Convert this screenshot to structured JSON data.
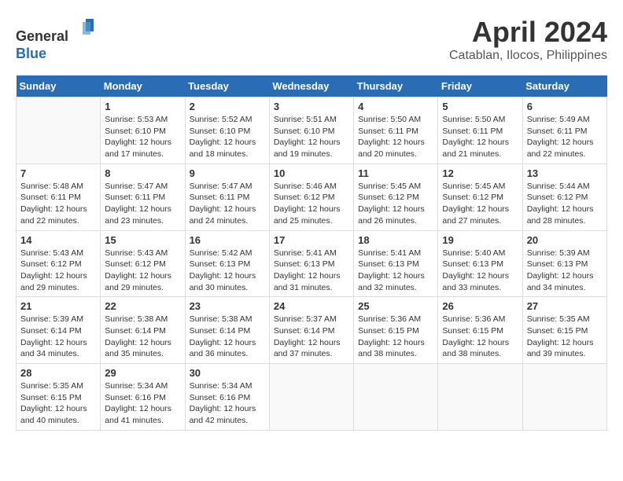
{
  "header": {
    "logo_line1": "General",
    "logo_line2": "Blue",
    "month": "April 2024",
    "location": "Catablan, Ilocos, Philippines"
  },
  "calendar": {
    "days_of_week": [
      "Sunday",
      "Monday",
      "Tuesday",
      "Wednesday",
      "Thursday",
      "Friday",
      "Saturday"
    ],
    "weeks": [
      [
        {
          "day": "",
          "info": ""
        },
        {
          "day": "1",
          "info": "Sunrise: 5:53 AM\nSunset: 6:10 PM\nDaylight: 12 hours\nand 17 minutes."
        },
        {
          "day": "2",
          "info": "Sunrise: 5:52 AM\nSunset: 6:10 PM\nDaylight: 12 hours\nand 18 minutes."
        },
        {
          "day": "3",
          "info": "Sunrise: 5:51 AM\nSunset: 6:10 PM\nDaylight: 12 hours\nand 19 minutes."
        },
        {
          "day": "4",
          "info": "Sunrise: 5:50 AM\nSunset: 6:11 PM\nDaylight: 12 hours\nand 20 minutes."
        },
        {
          "day": "5",
          "info": "Sunrise: 5:50 AM\nSunset: 6:11 PM\nDaylight: 12 hours\nand 21 minutes."
        },
        {
          "day": "6",
          "info": "Sunrise: 5:49 AM\nSunset: 6:11 PM\nDaylight: 12 hours\nand 22 minutes."
        }
      ],
      [
        {
          "day": "7",
          "info": "Sunrise: 5:48 AM\nSunset: 6:11 PM\nDaylight: 12 hours\nand 22 minutes."
        },
        {
          "day": "8",
          "info": "Sunrise: 5:47 AM\nSunset: 6:11 PM\nDaylight: 12 hours\nand 23 minutes."
        },
        {
          "day": "9",
          "info": "Sunrise: 5:47 AM\nSunset: 6:11 PM\nDaylight: 12 hours\nand 24 minutes."
        },
        {
          "day": "10",
          "info": "Sunrise: 5:46 AM\nSunset: 6:12 PM\nDaylight: 12 hours\nand 25 minutes."
        },
        {
          "day": "11",
          "info": "Sunrise: 5:45 AM\nSunset: 6:12 PM\nDaylight: 12 hours\nand 26 minutes."
        },
        {
          "day": "12",
          "info": "Sunrise: 5:45 AM\nSunset: 6:12 PM\nDaylight: 12 hours\nand 27 minutes."
        },
        {
          "day": "13",
          "info": "Sunrise: 5:44 AM\nSunset: 6:12 PM\nDaylight: 12 hours\nand 28 minutes."
        }
      ],
      [
        {
          "day": "14",
          "info": "Sunrise: 5:43 AM\nSunset: 6:12 PM\nDaylight: 12 hours\nand 29 minutes."
        },
        {
          "day": "15",
          "info": "Sunrise: 5:43 AM\nSunset: 6:12 PM\nDaylight: 12 hours\nand 29 minutes."
        },
        {
          "day": "16",
          "info": "Sunrise: 5:42 AM\nSunset: 6:13 PM\nDaylight: 12 hours\nand 30 minutes."
        },
        {
          "day": "17",
          "info": "Sunrise: 5:41 AM\nSunset: 6:13 PM\nDaylight: 12 hours\nand 31 minutes."
        },
        {
          "day": "18",
          "info": "Sunrise: 5:41 AM\nSunset: 6:13 PM\nDaylight: 12 hours\nand 32 minutes."
        },
        {
          "day": "19",
          "info": "Sunrise: 5:40 AM\nSunset: 6:13 PM\nDaylight: 12 hours\nand 33 minutes."
        },
        {
          "day": "20",
          "info": "Sunrise: 5:39 AM\nSunset: 6:13 PM\nDaylight: 12 hours\nand 34 minutes."
        }
      ],
      [
        {
          "day": "21",
          "info": "Sunrise: 5:39 AM\nSunset: 6:14 PM\nDaylight: 12 hours\nand 34 minutes."
        },
        {
          "day": "22",
          "info": "Sunrise: 5:38 AM\nSunset: 6:14 PM\nDaylight: 12 hours\nand 35 minutes."
        },
        {
          "day": "23",
          "info": "Sunrise: 5:38 AM\nSunset: 6:14 PM\nDaylight: 12 hours\nand 36 minutes."
        },
        {
          "day": "24",
          "info": "Sunrise: 5:37 AM\nSunset: 6:14 PM\nDaylight: 12 hours\nand 37 minutes."
        },
        {
          "day": "25",
          "info": "Sunrise: 5:36 AM\nSunset: 6:15 PM\nDaylight: 12 hours\nand 38 minutes."
        },
        {
          "day": "26",
          "info": "Sunrise: 5:36 AM\nSunset: 6:15 PM\nDaylight: 12 hours\nand 38 minutes."
        },
        {
          "day": "27",
          "info": "Sunrise: 5:35 AM\nSunset: 6:15 PM\nDaylight: 12 hours\nand 39 minutes."
        }
      ],
      [
        {
          "day": "28",
          "info": "Sunrise: 5:35 AM\nSunset: 6:15 PM\nDaylight: 12 hours\nand 40 minutes."
        },
        {
          "day": "29",
          "info": "Sunrise: 5:34 AM\nSunset: 6:16 PM\nDaylight: 12 hours\nand 41 minutes."
        },
        {
          "day": "30",
          "info": "Sunrise: 5:34 AM\nSunset: 6:16 PM\nDaylight: 12 hours\nand 42 minutes."
        },
        {
          "day": "",
          "info": ""
        },
        {
          "day": "",
          "info": ""
        },
        {
          "day": "",
          "info": ""
        },
        {
          "day": "",
          "info": ""
        }
      ]
    ]
  }
}
